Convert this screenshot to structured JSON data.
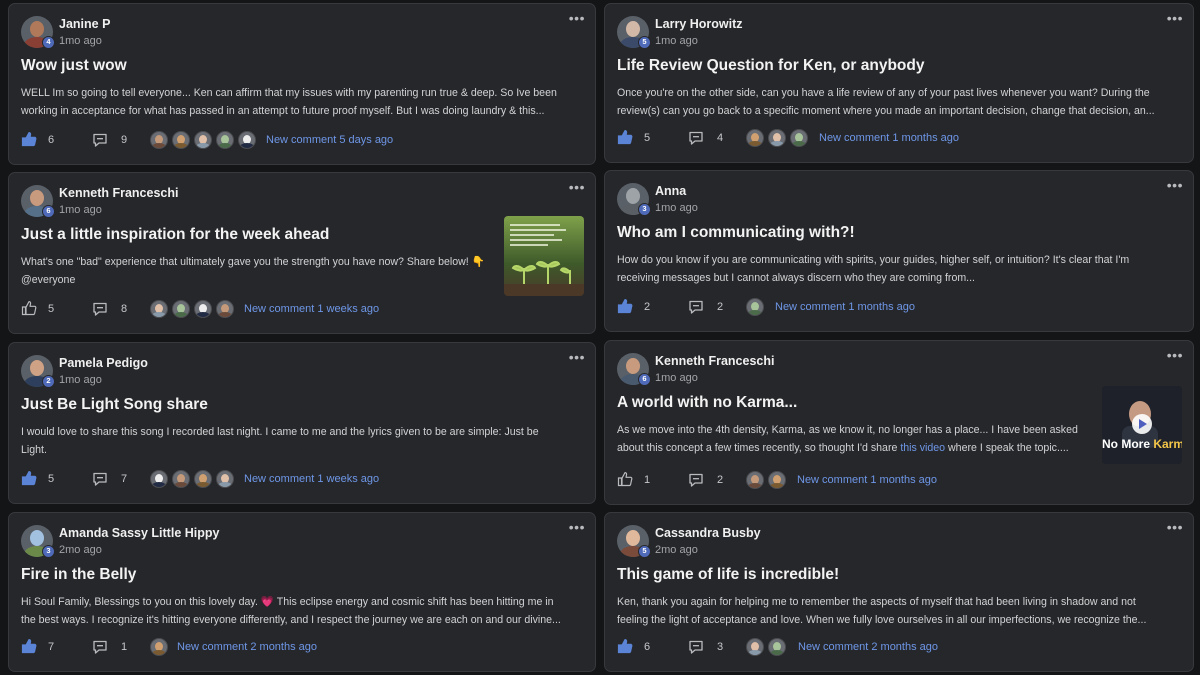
{
  "feed": {
    "posts": [
      {
        "author": "Janine P",
        "level": "4",
        "time": "1mo ago",
        "title": "Wow just wow",
        "excerpt_lines": [
          "WELL Im so going to tell everyone... Ken can affirm that my issues with my parenting run true & deep. So Ive been",
          "working in acceptance for what has passed in an attempt to future proof myself. But I was doing laundry & this..."
        ],
        "likes": "6",
        "comments": "9",
        "liked": true,
        "new_comment": "New comment 5 days ago",
        "commenter_icons": [
          "commenter-avatar",
          "commenter-avatar",
          "commenter-avatar",
          "commenter-avatar",
          "commenter-avatar"
        ]
      },
      {
        "author": "Larry Horowitz",
        "level": "5",
        "time": "1mo ago",
        "title": "Life Review Question for Ken, or anybody",
        "excerpt_lines": [
          "Once you're on the other side, can you have a life review of any of your past lives whenever you want? During the",
          "review(s) can you go back to a specific moment where you made an important decision, change that decision, an..."
        ],
        "likes": "5",
        "comments": "4",
        "liked": true,
        "new_comment": "New comment 1 months ago",
        "commenter_icons": [
          "commenter-avatar",
          "commenter-avatar",
          "commenter-avatar"
        ]
      },
      {
        "author": "Kenneth Franceschi",
        "level": "6",
        "time": "1mo ago",
        "title": "Just a little inspiration for the week ahead",
        "excerpt_lines": [
          "What's one \"bad\" experience that ultimately gave you the strength you have now? Share below! 👇",
          "@everyone"
        ],
        "likes": "5",
        "comments": "8",
        "liked": false,
        "new_comment": "New comment 1 weeks ago",
        "commenter_icons": [
          "commenter-avatar",
          "commenter-avatar",
          "commenter-avatar",
          "commenter-avatar"
        ],
        "thumbnail": "seedlings-quote-image"
      },
      {
        "author": "Anna",
        "level": "3",
        "time": "1mo ago",
        "title": "Who am I communicating with?!",
        "excerpt_lines": [
          "How do you know if you are communicating with spirits, your guides, higher self, or intuition? It's clear that I'm",
          "receiving messages but I cannot always discern who they are coming from..."
        ],
        "likes": "2",
        "comments": "2",
        "liked": true,
        "new_comment": "New comment 1 months ago",
        "commenter_icons": [
          "commenter-avatar"
        ]
      },
      {
        "author": "Pamela Pedigo",
        "level": "2",
        "time": "1mo ago",
        "title": "Just Be Light Song share",
        "excerpt_lines": [
          "I would love to share this song I recorded last night. I came to me and the lyrics given to be are simple: Just be",
          "Light."
        ],
        "likes": "5",
        "comments": "7",
        "liked": true,
        "new_comment": "New comment 1 weeks ago",
        "commenter_icons": [
          "commenter-avatar",
          "commenter-avatar",
          "commenter-avatar",
          "commenter-avatar"
        ]
      },
      {
        "author": "Kenneth Franceschi",
        "level": "6",
        "time": "1mo ago",
        "title": "A world with no Karma...",
        "excerpt_lines": [
          "As we move into the 4th density, Karma, as we know it, no longer has a place... I have been asked",
          "about this concept a few times recently, so thought I'd share "
        ],
        "excerpt_link": "this video",
        "excerpt_after": " where I speak the topic....",
        "likes": "1",
        "comments": "2",
        "liked": false,
        "new_comment": "New comment 1 months ago",
        "commenter_icons": [
          "commenter-avatar",
          "commenter-avatar"
        ],
        "thumbnail": "video-thumbnail",
        "thumb_text_a": "No More ",
        "thumb_text_b": "Karma?"
      },
      {
        "author": "Amanda Sassy Little Hippy",
        "level": "3",
        "time": "2mo ago",
        "title": "Fire in the Belly",
        "excerpt_lines": [
          "Hi Soul Family, Blessings to you on this lovely day. 💗 This eclipse energy and cosmic shift has been hitting me in",
          "the best ways. I recognize it's hitting everyone differently, and I respect the journey we are each on and our divine..."
        ],
        "likes": "7",
        "comments": "1",
        "liked": true,
        "new_comment": "New comment 2 months ago",
        "commenter_icons": [
          "commenter-avatar"
        ]
      },
      {
        "author": "Cassandra Busby",
        "level": "5",
        "time": "2mo ago",
        "title": "This game of life is incredible!",
        "excerpt_lines": [
          "Ken, thank you again for helping me to remember the aspects of myself that had been living in shadow and not",
          "feeling the light of acceptance and love. When we fully love ourselves in all our imperfections, we recognize the..."
        ],
        "likes": "6",
        "comments": "3",
        "liked": true,
        "new_comment": "New comment 2 months ago",
        "commenter_icons": [
          "commenter-avatar",
          "commenter-avatar"
        ]
      }
    ]
  },
  "icons": {
    "menu": "more-options-icon",
    "like": "thumbs-up-icon",
    "comment": "comment-bubble-icon",
    "play": "play-icon"
  },
  "colors": {
    "background": "#141517",
    "card": "#26272a",
    "border": "#38393d",
    "accent_link": "#6e97e8",
    "like_active": "#5b84d6",
    "level_badge": "#4f6ab8"
  }
}
